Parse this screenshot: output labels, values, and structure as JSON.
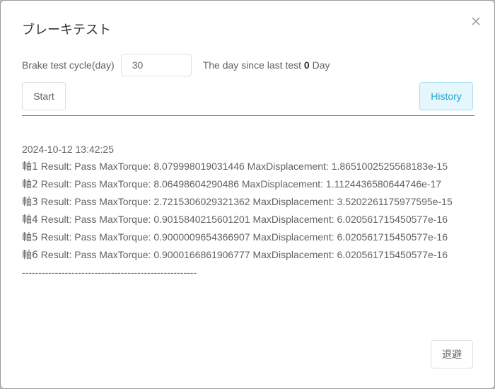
{
  "dialog": {
    "title": "ブレーキテスト",
    "close_icon": "close-icon"
  },
  "cycle": {
    "label": "Brake test cycle(day)",
    "value": "30",
    "since_prefix": "The day since last test",
    "since_value": "0",
    "since_suffix": "Day"
  },
  "buttons": {
    "start": "Start",
    "history": "History",
    "leave": "退避"
  },
  "colors": {
    "history_bg": "#e6f6fd",
    "history_text": "#24a4d4",
    "history_border": "#a7dcf2"
  },
  "log": {
    "timestamp": "2024-10-12 13:42:25",
    "entries": [
      {
        "axis": "軸1",
        "text": " Result: Pass MaxTorque: 8.079998019031446 MaxDisplacement: 1.8651002525568183e-15"
      },
      {
        "axis": "軸2",
        "text": " Result: Pass MaxTorque: 8.06498604290486 MaxDisplacement: 1.1124436580644746e-17"
      },
      {
        "axis": "軸3",
        "text": " Result: Pass MaxTorque: 2.7215306029321362 MaxDisplacement: 3.5202261175977595e-15"
      },
      {
        "axis": "軸4",
        "text": " Result: Pass MaxTorque: 0.9015840215601201 MaxDisplacement: 6.020561715450577e-16"
      },
      {
        "axis": "軸5",
        "text": " Result: Pass MaxTorque: 0.9000009654366907 MaxDisplacement: 6.020561715450577e-16"
      },
      {
        "axis": "軸6",
        "text": " Result: Pass MaxTorque: 0.9000166861906777 MaxDisplacement: 6.020561715450577e-16"
      }
    ],
    "separator": "-----------------------------------------------------"
  }
}
